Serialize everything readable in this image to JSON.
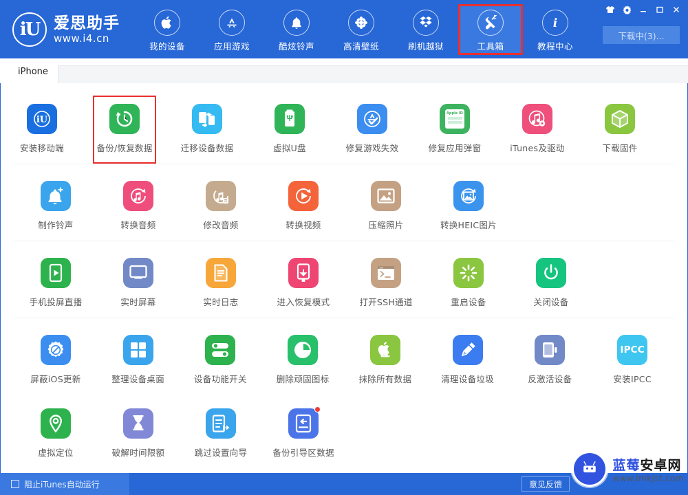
{
  "app": {
    "brand_logo_text": "iU",
    "brand_name": "爱思助手",
    "brand_url": "www.i4.cn"
  },
  "header": {
    "nav": [
      {
        "label": "我的设备",
        "icon": "apple-icon",
        "active": false
      },
      {
        "label": "应用游戏",
        "icon": "appstore-icon",
        "active": false
      },
      {
        "label": "酷炫铃声",
        "icon": "bell-icon",
        "active": false
      },
      {
        "label": "高清壁纸",
        "icon": "flower-icon",
        "active": false
      },
      {
        "label": "刷机越狱",
        "icon": "box-icon",
        "active": false
      },
      {
        "label": "工具箱",
        "icon": "tools-icon",
        "active": true
      },
      {
        "label": "教程中心",
        "icon": "info-icon",
        "active": false
      }
    ],
    "window_buttons": [
      {
        "name": "skin-icon",
        "glyph": "skin"
      },
      {
        "name": "settings-gear-icon",
        "glyph": "gear"
      },
      {
        "name": "minimize-icon",
        "glyph": "minimize"
      },
      {
        "name": "maximize-icon",
        "glyph": "maximize"
      },
      {
        "name": "close-icon",
        "glyph": "close"
      }
    ],
    "download_button": "下载中(3)...",
    "highlight_color": "#e8302f",
    "bg_color": "#2767d6"
  },
  "tabs": [
    {
      "label": "iPhone",
      "active": true
    }
  ],
  "toolbox": {
    "groups": [
      {
        "rows": [
          [
            {
              "label": "安装移动端",
              "icon": "i4-app-icon",
              "color": "#1a6fe0",
              "boxed": false,
              "badge": false
            },
            {
              "label": "备份/恢复数据",
              "icon": "backup-restore-icon",
              "color": "#2fb457",
              "boxed": true,
              "badge": false
            },
            {
              "label": "迁移设备数据",
              "icon": "device-transfer-icon",
              "color": "#35baf1",
              "boxed": false,
              "badge": false
            },
            {
              "label": "虚拟U盘",
              "icon": "usb-drive-icon",
              "color": "#2fb457",
              "boxed": false,
              "badge": false
            },
            {
              "label": "修复游戏失效",
              "icon": "fix-game-icon",
              "color": "#3b8ef0",
              "boxed": false,
              "badge": false
            },
            {
              "label": "修复应用弹窗",
              "icon": "appleid-popup-icon",
              "color": "#3db35f",
              "boxed": false,
              "badge": false
            },
            {
              "label": "iTunes及驱动",
              "icon": "itunes-driver-icon",
              "color": "#ee4f7b",
              "boxed": false,
              "badge": false
            },
            {
              "label": "下载固件",
              "icon": "firmware-cube-icon",
              "color": "#8ac63f",
              "boxed": false,
              "badge": false
            }
          ]
        ]
      },
      {
        "rows": [
          [
            {
              "label": "制作铃声",
              "icon": "make-ringtone-icon",
              "color": "#3aa5ec",
              "boxed": false,
              "badge": false
            },
            {
              "label": "转换音频",
              "icon": "convert-audio-icon",
              "color": "#ef4d7c",
              "boxed": false,
              "badge": false
            },
            {
              "label": "修改音频",
              "icon": "edit-audio-icon",
              "color": "#c4ab8f",
              "boxed": false,
              "badge": false
            },
            {
              "label": "转换视频",
              "icon": "convert-video-icon",
              "color": "#f4633a",
              "boxed": false,
              "badge": false
            },
            {
              "label": "压缩照片",
              "icon": "compress-photo-icon",
              "color": "#c4a183",
              "boxed": false,
              "badge": false
            },
            {
              "label": "转换HEIC图片",
              "icon": "convert-heic-icon",
              "color": "#3a93ec",
              "boxed": false,
              "badge": false
            }
          ]
        ]
      },
      {
        "rows": [
          [
            {
              "label": "手机投屏直播",
              "icon": "screen-cast-icon",
              "color": "#2db24d",
              "boxed": false,
              "badge": false
            },
            {
              "label": "实时屏幕",
              "icon": "live-screen-icon",
              "color": "#7289c8",
              "boxed": false,
              "badge": false
            },
            {
              "label": "实时日志",
              "icon": "live-log-icon",
              "color": "#f7a63a",
              "boxed": false,
              "badge": false
            },
            {
              "label": "进入恢复模式",
              "icon": "recovery-mode-icon",
              "color": "#ee4573",
              "boxed": false,
              "badge": false
            },
            {
              "label": "打开SSH通道",
              "icon": "ssh-terminal-icon",
              "color": "#c4a183",
              "boxed": false,
              "badge": false
            },
            {
              "label": "重启设备",
              "icon": "reboot-device-icon",
              "color": "#8ac63f",
              "boxed": false,
              "badge": false
            },
            {
              "label": "关闭设备",
              "icon": "power-off-icon",
              "color": "#15c57f",
              "boxed": false,
              "badge": false
            }
          ]
        ]
      },
      {
        "rows": [
          [
            {
              "label": "屏蔽iOS更新",
              "icon": "block-ios-update-icon",
              "color": "#3b8ef0",
              "boxed": false,
              "badge": false
            },
            {
              "label": "整理设备桌面",
              "icon": "organize-desktop-icon",
              "color": "#3aa5ec",
              "boxed": false,
              "badge": false
            },
            {
              "label": "设备功能开关",
              "icon": "feature-toggle-icon",
              "color": "#2db24d",
              "boxed": false,
              "badge": false
            },
            {
              "label": "删除顽固图标",
              "icon": "delete-icon-icon",
              "color": "#28c06a",
              "boxed": false,
              "badge": false
            },
            {
              "label": "抹除所有数据",
              "icon": "erase-all-icon",
              "color": "#8ac63f",
              "boxed": false,
              "badge": false
            },
            {
              "label": "清理设备垃圾",
              "icon": "clean-junk-icon",
              "color": "#3b7cf0",
              "boxed": false,
              "badge": false
            },
            {
              "label": "反激活设备",
              "icon": "deactivate-device-icon",
              "color": "#7289c8",
              "boxed": false,
              "badge": false
            },
            {
              "label": "安装IPCC",
              "icon": "install-ipcc-icon",
              "color": "#3fc6f0",
              "boxed": false,
              "badge": false
            }
          ],
          [
            {
              "label": "虚拟定位",
              "icon": "virtual-location-icon",
              "color": "#2db24d",
              "boxed": false,
              "badge": false
            },
            {
              "label": "破解时间限额",
              "icon": "time-limit-icon",
              "color": "#8189d6",
              "boxed": false,
              "badge": false
            },
            {
              "label": "跳过设置向导",
              "icon": "skip-setup-icon",
              "color": "#3aa5ec",
              "boxed": false,
              "badge": false
            },
            {
              "label": "备份引导区数据",
              "icon": "backup-boot-icon",
              "color": "#4b74e8",
              "boxed": false,
              "badge": true
            }
          ]
        ]
      }
    ]
  },
  "statusbar": {
    "checkbox_label": "阻止iTunes自动运行",
    "checkbox_checked": false,
    "feedback_button": "意见反馈"
  },
  "watermark": {
    "title_blue": "蓝莓",
    "title_dark": "安卓网",
    "url": "www.lmkjst.com"
  }
}
